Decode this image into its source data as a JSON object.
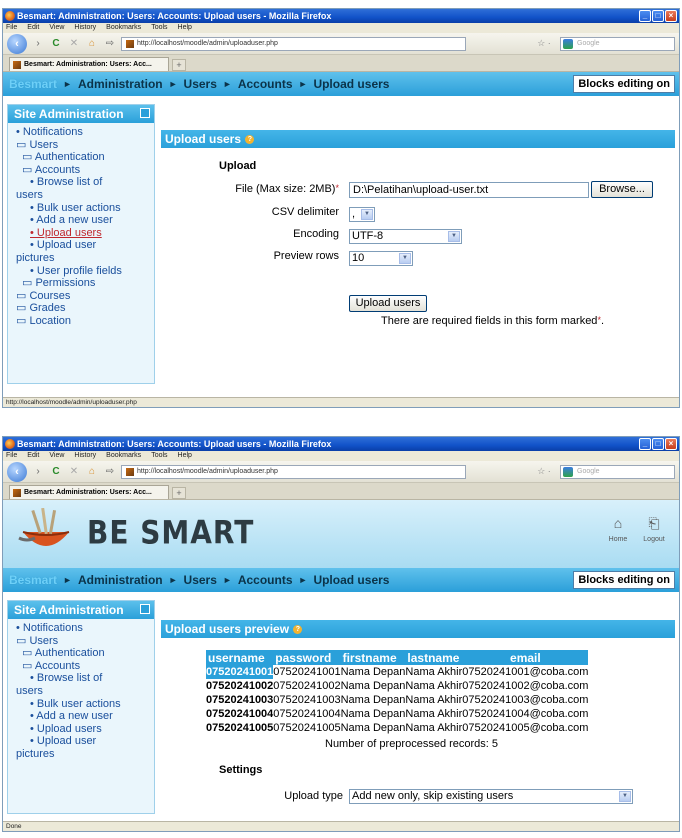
{
  "window": {
    "title": "Besmart: Administration: Users: Accounts: Upload users - Mozilla Firefox",
    "menu": [
      "File",
      "Edit",
      "View",
      "History",
      "Bookmarks",
      "Tools",
      "Help"
    ],
    "min": "_",
    "max": "□",
    "close": "×"
  },
  "browser": {
    "back": "‹",
    "forward": "›",
    "reload": "C",
    "stop": "✕",
    "home": "⌂",
    "bookmark": "⇨",
    "url": "http://localhost/moodle/admin/uploaduser.php",
    "star": "☆ ·",
    "search_placeholder": "Google",
    "tab_title": "Besmart: Administration: Users: Acc...",
    "new_tab": "+"
  },
  "breadcrumb": {
    "home": "Besmart",
    "sep": "►",
    "items": [
      "Administration",
      "Users",
      "Accounts",
      "Upload users"
    ]
  },
  "blocks_editing": "Blocks editing on",
  "sidebar": {
    "title": "Site Administration",
    "items": [
      {
        "label": "• Notifications",
        "level": 1
      },
      {
        "label": "▭ Users",
        "level": 1
      },
      {
        "label": "▭ Authentication",
        "level": 2
      },
      {
        "label": "▭ Accounts",
        "level": 2
      },
      {
        "label": "• Browse list of",
        "level": 3
      },
      {
        "label": "users",
        "level": "wrap"
      },
      {
        "label": "• Bulk user actions",
        "level": 3
      },
      {
        "label": "• Add a new user",
        "level": 3
      },
      {
        "label": "• Upload users",
        "level": 3
      },
      {
        "label": "• Upload user",
        "level": 3
      },
      {
        "label": "pictures",
        "level": "wrap"
      },
      {
        "label": "• User profile fields",
        "level": 3
      },
      {
        "label": "▭ Permissions",
        "level": 2
      },
      {
        "label": "▭ Courses",
        "level": 1
      },
      {
        "label": "▭ Grades",
        "level": 1
      },
      {
        "label": "▭ Location",
        "level": 1
      }
    ]
  },
  "upload_form": {
    "heading": "Upload users",
    "help": "?",
    "section": "Upload",
    "file_label": "File (Max size: 2MB)",
    "required_mark": "*",
    "file_value": "D:\\Pelatihan\\upload-user.txt",
    "browse": "Browse...",
    "csv_label": "CSV delimiter",
    "csv_value": ",",
    "encoding_label": "Encoding",
    "encoding_value": "UTF-8",
    "preview_label": "Preview rows",
    "preview_value": "10",
    "submit": "Upload users",
    "required_note": "There are required fields in this form marked",
    "required_note_end": "."
  },
  "status1": "http://localhost/moodle/admin/uploaduser.php",
  "banner": {
    "logo": "BE SMART",
    "home": "Home",
    "logout": "Logout"
  },
  "preview": {
    "heading": "Upload users preview",
    "columns": [
      "username",
      "password",
      "firstname",
      "lastname",
      "email"
    ],
    "rows": [
      [
        "07520241001",
        "07520241001",
        "Nama Depan",
        "Nama Akhir",
        "07520241001@coba.com"
      ],
      [
        "07520241002",
        "07520241002",
        "Nama Depan",
        "Nama Akhir",
        "07520241002@coba.com"
      ],
      [
        "07520241003",
        "07520241003",
        "Nama Depan",
        "Nama Akhir",
        "07520241003@coba.com"
      ],
      [
        "07520241004",
        "07520241004",
        "Nama Depan",
        "Nama Akhir",
        "07520241004@coba.com"
      ],
      [
        "07520241005",
        "07520241005",
        "Nama Depan",
        "Nama Akhir",
        "07520241005@coba.com"
      ]
    ],
    "count": "Number of preprocessed records: 5",
    "settings": "Settings",
    "upload_type_label": "Upload type",
    "upload_type_value": "Add new only, skip existing users"
  },
  "sidebar2": [
    {
      "label": "• Notifications",
      "level": 1
    },
    {
      "label": "▭ Users",
      "level": 1
    },
    {
      "label": "▭ Authentication",
      "level": 2
    },
    {
      "label": "▭ Accounts",
      "level": 2
    },
    {
      "label": "• Browse list of",
      "level": 3
    },
    {
      "label": "users",
      "level": "wrap"
    },
    {
      "label": "• Bulk user actions",
      "level": 3
    },
    {
      "label": "• Add a new user",
      "level": 3
    },
    {
      "label": "• Upload users",
      "level": 3
    },
    {
      "label": "• Upload user",
      "level": 3
    },
    {
      "label": "pictures",
      "level": "wrap"
    }
  ],
  "status2": "Done"
}
